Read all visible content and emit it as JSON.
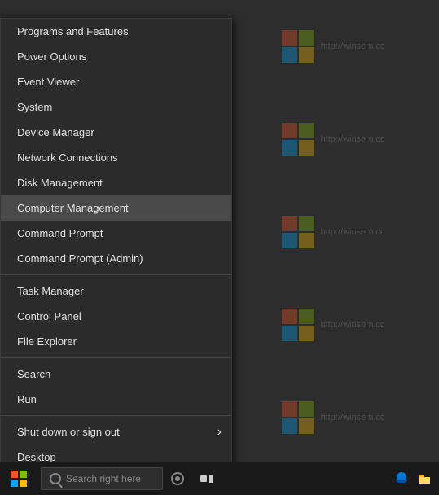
{
  "desktop": {
    "background_color": "#2d2d2d"
  },
  "watermarks": [
    {
      "text": "http://winsem.cc"
    },
    {
      "text": "http://winsem.cc"
    },
    {
      "text": "http://winsem.cc"
    },
    {
      "text": "http://winsem.cc"
    },
    {
      "text": "http://winsem.cc"
    }
  ],
  "context_menu": {
    "items": [
      {
        "id": "programs-features",
        "label": "Programs and Features",
        "highlighted": false,
        "separator_after": false,
        "has_submenu": false
      },
      {
        "id": "power-options",
        "label": "Power Options",
        "highlighted": false,
        "separator_after": false,
        "has_submenu": false
      },
      {
        "id": "event-viewer",
        "label": "Event Viewer",
        "highlighted": false,
        "separator_after": false,
        "has_submenu": false
      },
      {
        "id": "system",
        "label": "System",
        "highlighted": false,
        "separator_after": false,
        "has_submenu": false
      },
      {
        "id": "device-manager",
        "label": "Device Manager",
        "highlighted": false,
        "separator_after": false,
        "has_submenu": false
      },
      {
        "id": "network-connections",
        "label": "Network Connections",
        "highlighted": false,
        "separator_after": false,
        "has_submenu": false
      },
      {
        "id": "disk-management",
        "label": "Disk Management",
        "highlighted": false,
        "separator_after": false,
        "has_submenu": false
      },
      {
        "id": "computer-management",
        "label": "Computer Management",
        "highlighted": true,
        "separator_after": false,
        "has_submenu": false
      },
      {
        "id": "command-prompt",
        "label": "Command Prompt",
        "highlighted": false,
        "separator_after": false,
        "has_submenu": false
      },
      {
        "id": "command-prompt-admin",
        "label": "Command Prompt (Admin)",
        "highlighted": false,
        "separator_after": true,
        "has_submenu": false
      },
      {
        "id": "task-manager",
        "label": "Task Manager",
        "highlighted": false,
        "separator_after": false,
        "has_submenu": false
      },
      {
        "id": "control-panel",
        "label": "Control Panel",
        "highlighted": false,
        "separator_after": false,
        "has_submenu": false
      },
      {
        "id": "file-explorer",
        "label": "File Explorer",
        "highlighted": false,
        "separator_after": true,
        "has_submenu": false
      },
      {
        "id": "search",
        "label": "Search",
        "highlighted": false,
        "separator_after": false,
        "has_submenu": false
      },
      {
        "id": "run",
        "label": "Run",
        "highlighted": false,
        "separator_after": true,
        "has_submenu": false
      },
      {
        "id": "shut-down",
        "label": "Shut down or sign out",
        "highlighted": false,
        "separator_after": false,
        "has_submenu": true
      },
      {
        "id": "desktop",
        "label": "Desktop",
        "highlighted": false,
        "separator_after": false,
        "has_submenu": false
      }
    ]
  },
  "taskbar": {
    "search_placeholder": "Search right here",
    "icons": {
      "start": "windows-start",
      "search": "search-icon",
      "cortana": "cortana-icon",
      "taskview": "taskview-icon",
      "edge": "edge-icon",
      "folder": "folder-icon"
    }
  }
}
